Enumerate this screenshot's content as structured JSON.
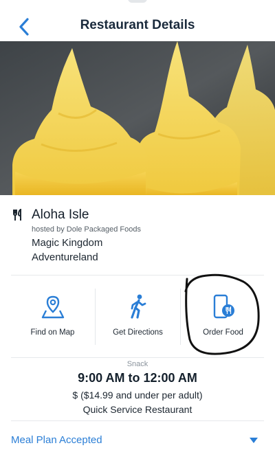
{
  "header": {
    "title": "Restaurant Details",
    "back_icon": "chevron-left-icon"
  },
  "hero": {
    "description_icon": "dole-whip-photo"
  },
  "restaurant": {
    "name": "Aloha Isle",
    "host": "hosted by Dole Packaged Foods",
    "park": "Magic Kingdom",
    "land": "Adventureland",
    "icon": "fork-knife-icon"
  },
  "actions": [
    {
      "label": "Find on Map",
      "icon": "map-pin-icon"
    },
    {
      "label": "Get Directions",
      "icon": "walking-person-icon"
    },
    {
      "label": "Order Food",
      "icon": "mobile-order-icon"
    }
  ],
  "details": {
    "meal_type": "Snack",
    "hours": "9:00 AM to 12:00 AM",
    "price": "$ ($14.99 and under per adult)",
    "service": "Quick Service Restaurant"
  },
  "meal_plan": {
    "label": "Meal Plan Accepted",
    "icon": "caret-down-icon"
  },
  "colors": {
    "accent": "#2a7ed6",
    "title": "#1a2a3c",
    "divider": "#e6e8eb"
  }
}
